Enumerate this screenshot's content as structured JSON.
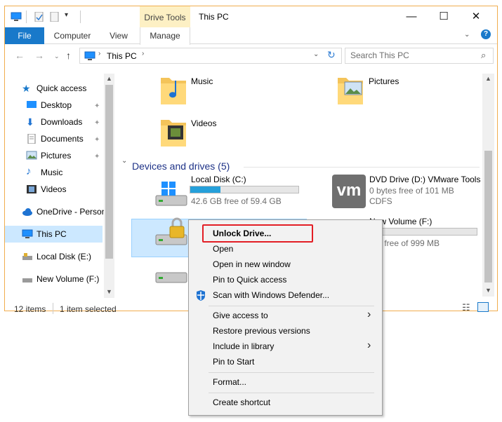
{
  "window": {
    "title": "This PC",
    "contextual_tab": "Drive Tools",
    "controls": {
      "minimize": "—",
      "maximize": "☐",
      "close": "✕"
    }
  },
  "ribbon": {
    "tabs": [
      "File",
      "Computer",
      "View",
      "Manage"
    ]
  },
  "address": {
    "path_item": "This PC",
    "search_placeholder": "Search This PC"
  },
  "nav_pane": {
    "items": [
      {
        "label": "Quick access",
        "icon": "star-icon",
        "pinned": false
      },
      {
        "label": "Desktop",
        "icon": "desktop-icon",
        "pinned": true
      },
      {
        "label": "Downloads",
        "icon": "download-icon",
        "pinned": true
      },
      {
        "label": "Documents",
        "icon": "documents-icon",
        "pinned": true
      },
      {
        "label": "Pictures",
        "icon": "pictures-icon",
        "pinned": true
      },
      {
        "label": "Music",
        "icon": "music-icon",
        "pinned": false
      },
      {
        "label": "Videos",
        "icon": "videos-icon",
        "pinned": false
      },
      {
        "label": "OneDrive - Person",
        "icon": "cloud-icon",
        "pinned": false
      },
      {
        "label": "This PC",
        "icon": "computer-icon",
        "pinned": false
      },
      {
        "label": "Local Disk (E:)",
        "icon": "drive-icon",
        "pinned": false
      },
      {
        "label": "New Volume (F:)",
        "icon": "drive-icon",
        "pinned": false
      }
    ],
    "pin_glyph": "📌"
  },
  "folders": [
    {
      "label": "Music"
    },
    {
      "label": "Pictures"
    },
    {
      "label": "Videos"
    }
  ],
  "section": {
    "title": "Devices and drives (5)"
  },
  "drives": [
    {
      "name": "Local Disk (C:)",
      "detail": "42.6 GB free of 59.4 GB",
      "used_fraction": 0.28
    },
    {
      "name": "DVD Drive (D:) VMware Tools",
      "detail": "0 bytes free of 101 MB",
      "detail2": "CDFS",
      "logo": "vm"
    },
    {
      "name": "New Volume (F:)",
      "detail": "MB free of 999 MB",
      "used_fraction": 0.0
    }
  ],
  "status": {
    "items_count": "12 items",
    "selected": "1 item selected"
  },
  "context_menu": {
    "items": [
      {
        "label": "Unlock Drive...",
        "bold": true
      },
      {
        "label": "Open"
      },
      {
        "label": "Open in new window"
      },
      {
        "label": "Pin to Quick access"
      },
      {
        "label": "Scan with Windows Defender...",
        "icon": "defender-shield-icon"
      },
      {
        "label": "Give access to",
        "submenu": true
      },
      {
        "label": "Restore previous versions"
      },
      {
        "label": "Include in library",
        "submenu": true
      },
      {
        "label": "Pin to Start"
      },
      {
        "label": "Format..."
      },
      {
        "label": "Create shortcut"
      }
    ],
    "submenu_glyph": "›"
  },
  "colors": {
    "accent": "#1979ca",
    "selection": "#cce8ff",
    "highlight_box": "#e31e25",
    "capacity_fill": "#26a0da"
  }
}
